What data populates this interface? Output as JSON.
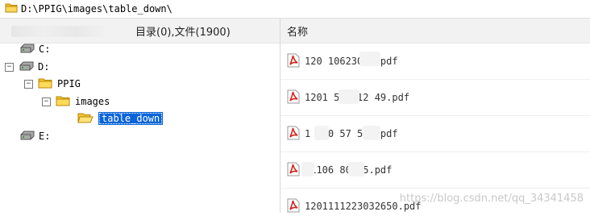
{
  "path_bar": {
    "path": "D:\\PPIG\\images\\table_down\\"
  },
  "headers": {
    "left": "目录(0),文件(1900)",
    "right": "名称"
  },
  "tree": {
    "c_drive": "C:",
    "d_drive": "D:",
    "ppig": "PPIG",
    "images": "images",
    "table_down": "table_down",
    "e_drive": "E:"
  },
  "files": [
    {
      "name": "120 106230 2.pdf"
    },
    {
      "name": "1201 523012 49.pdf"
    },
    {
      "name": "1 110 57 500.pdf"
    },
    {
      "name": "01106 80355.pdf"
    },
    {
      "name": "1201111223032650.pdf"
    }
  ],
  "watermark": "https://blog.csdn.net/qq_34341458",
  "colors": {
    "selection": "#0a64d8",
    "pdf_red": "#d4261c",
    "folder_yellow": "#f2c531"
  }
}
